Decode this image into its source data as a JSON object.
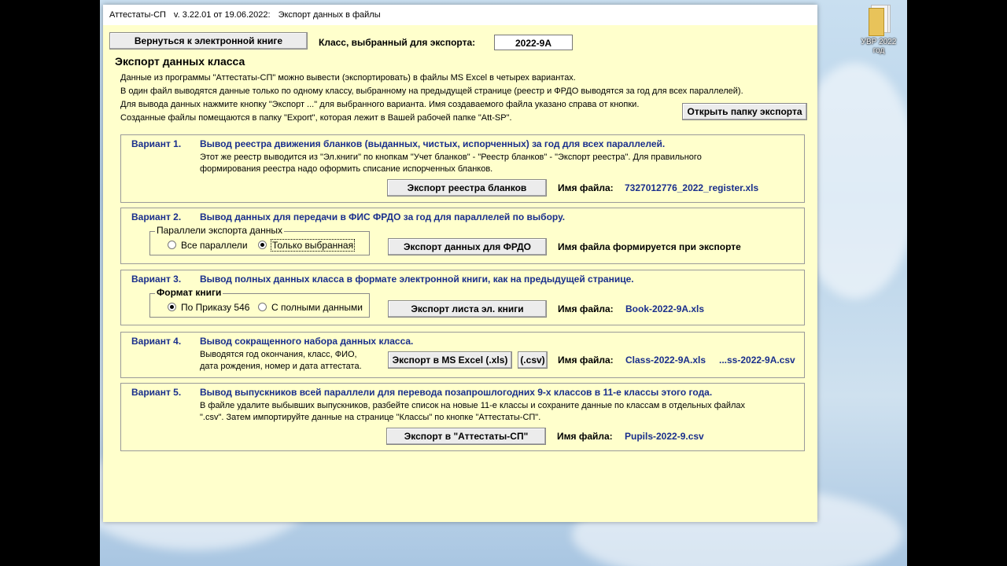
{
  "desktop": {
    "icon_label": "УВР 2022 год"
  },
  "window": {
    "app_name": "Аттестаты-СП",
    "version": "v. 3.22.01 от 19.06.2022:",
    "screen": "Экспорт данных в файлы"
  },
  "top": {
    "back_button": "Вернуться к электронной книге",
    "class_label": "Класс, выбранный для экспорта:",
    "class_value": "2022-9А"
  },
  "intro": {
    "title": "Экспорт данных класса",
    "lines": [
      "Данные из программы  \"Аттестаты-СП\"  можно вывести (экспортировать)  в файлы MS Excel в четырех вариантах.",
      "В один файл выводятся данные только по одному классу, выбранному на предыдущей странице (реестр и ФРДО выводятся за год для всех параллелей).",
      "Для вывода данных нажмите кнопку \"Экспорт ...\" для выбранного варианта. Имя создаваемого файла указано справа от кнопки.",
      "Созданные файлы помещаются в папку \"Export\", которая лежит в Вашей рабочей папке \"Att-SP\"."
    ],
    "open_folder_button": "Открыть папку экспорта"
  },
  "variants": [
    {
      "label": "Вариант 1.",
      "title": "Вывод реестра движения бланков (выданных, чистых, испорченных) за год для всех параллелей.",
      "desc": [
        "Этот же реестр выводится из \"Эл.книги\" по кнопкам \"Учет бланков\" - \"Реестр бланков\" - \"Экспорт реестра\". Для правильного",
        "формирования реестра надо оформить списание испорченных бланков."
      ],
      "button": "Экспорт реестра бланков",
      "file_label": "Имя файла:",
      "file_name": "7327012776_2022_register.xls"
    },
    {
      "label": "Вариант 2.",
      "title": "Вывод данных для передачи в ФИС ФРДО за год для параллелей по выбору.",
      "group_label": "Параллели экспорта данных",
      "options": [
        "Все параллели",
        "Только выбранная"
      ],
      "selected": 1,
      "button": "Экспорт данных для ФРДО",
      "file_note": "Имя файла формируется при экспорте"
    },
    {
      "label": "Вариант 3.",
      "title": "Вывод полных данных класса в формате электронной книги, как на предыдущей странице.",
      "group_label": "Формат книги",
      "options": [
        "По Приказу 546",
        "С полными данными"
      ],
      "selected": 0,
      "button": "Экспорт листа эл. книги",
      "file_label": "Имя файла:",
      "file_name": "Book-2022-9А.xls"
    },
    {
      "label": "Вариант 4.",
      "title": "Вывод сокращенного набора данных класса.",
      "desc": [
        "Выводятся год окончания, класс, ФИО,",
        "дата рождения, номер и дата аттестата."
      ],
      "button": "Экспорт в MS Excel (.xls)",
      "button2": "(.csv)",
      "file_label": "Имя файла:",
      "file_name": "Class-2022-9А.xls",
      "file_name2": "...ss-2022-9А.csv"
    },
    {
      "label": "Вариант 5.",
      "title": "Вывод выпускников  всей параллели для перевода позапрошлогодних 9-х классов в 11-е классы этого года.",
      "desc": [
        "В файле удалите выбывших выпускников, разбейте список на новые 11-е классы и сохраните данные по классам в отдельных файлах",
        "\".csv\". Затем импортируйте данные на странице \"Классы\" по кнопке \"Аттестаты-СП\"."
      ],
      "button": "Экспорт в \"Аттестаты-СП\"",
      "file_label": "Имя файла:",
      "file_name": "Pupils-2022-9.csv"
    }
  ]
}
